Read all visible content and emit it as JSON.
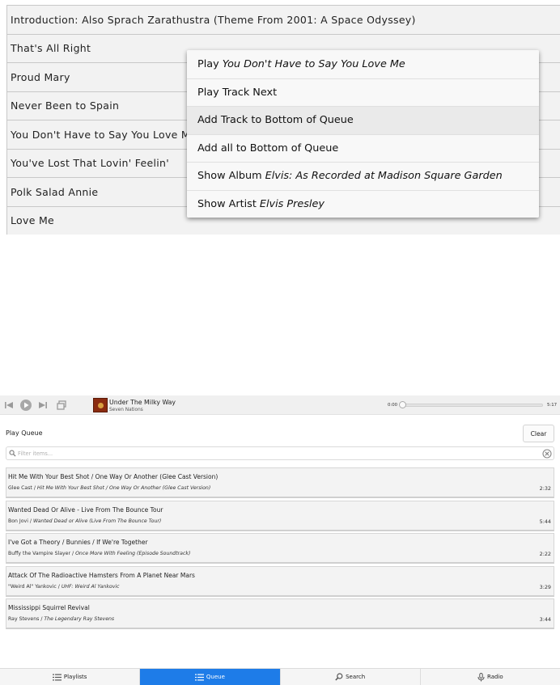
{
  "track_list": [
    "Introduction: Also Sprach Zarathustra (Theme From 2001: A Space Odyssey)",
    "That's All Right",
    "Proud Mary",
    "Never Been to Spain",
    "You Don't Have to Say You Love Me",
    "You've Lost That Lovin' Feelin'",
    "Polk Salad Annie",
    "Love Me"
  ],
  "context_menu": {
    "play_prefix": "Play",
    "play_track": "You Don't Have to Say You Love Me",
    "play_next": "Play Track Next",
    "add_track_bottom": "Add Track to Bottom of Queue",
    "add_all_bottom": "Add all to Bottom of Queue",
    "show_album_prefix": "Show Album",
    "album_name": "Elvis: As Recorded at Madison Square Garden",
    "show_artist_prefix": "Show Artist",
    "artist_name": "Elvis Presley"
  },
  "player": {
    "now_playing_title": "Under The Milky Way",
    "now_playing_artist": "Seven Nations",
    "time_elapsed": "0:00",
    "time_total": "5:17",
    "progress_fraction": 0.0
  },
  "queue": {
    "title": "Play Queue",
    "clear_label": "Clear",
    "filter_placeholder": "Filter items...",
    "items": [
      {
        "title": "Hit Me With Your Best Shot / One Way Or Another (Glee Cast Version)",
        "artist": "Glee Cast",
        "album": "Hit Me With Your Best Shot / One Way Or Another (Glee Cast Version)",
        "duration": "2:32"
      },
      {
        "title": "Wanted Dead Or Alive - Live From The Bounce Tour",
        "artist": "Bon Jovi",
        "album": "Wanted Dead or Alive (Live From The Bounce Tour)",
        "duration": "5:44"
      },
      {
        "title": "I've Got a Theory / Bunnies / If We're Together",
        "artist": "Buffy the Vampire Slayer",
        "album": "Once More With Feeling (Episode Soundtrack)",
        "duration": "2:22"
      },
      {
        "title": "Attack Of The Radioactive Hamsters From A Planet Near Mars",
        "artist": "\"Weird Al\" Yankovic",
        "album": "UHF: Weird Al Yankovic",
        "duration": "3:29"
      },
      {
        "title": "Mississippi Squirrel Revival",
        "artist": "Ray Stevens",
        "album": "The Legendary Ray Stevens",
        "duration": "3:44"
      }
    ]
  },
  "nav": {
    "playlists": "Playlists",
    "queue": "Queue",
    "search": "Search",
    "radio": "Radio"
  }
}
